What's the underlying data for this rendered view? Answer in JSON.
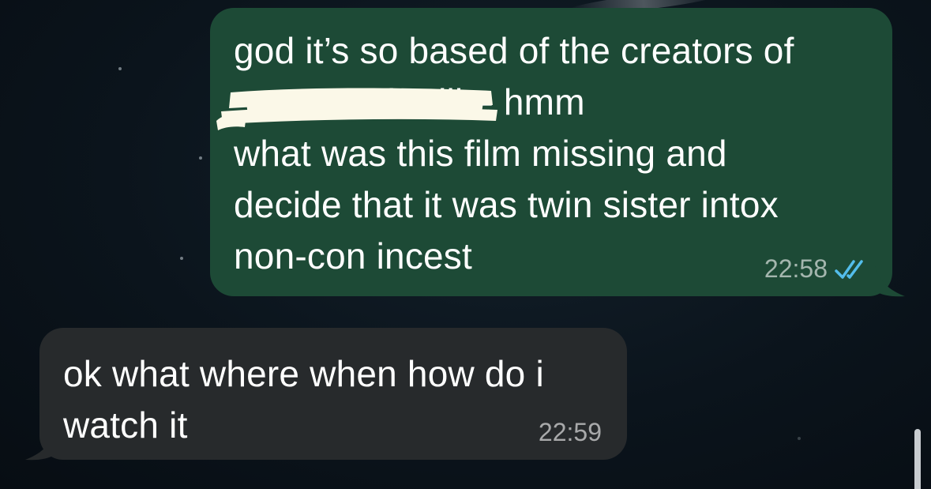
{
  "conversation": {
    "messages": [
      {
        "direction": "outgoing",
        "text": "god it’s so based of the creators of\n           to be like hmm\nwhat was this film missing and\ndecide that it was twin sister intox\nnon-con incest",
        "time": "22:58",
        "status_icon": "double-check-read-icon"
      },
      {
        "direction": "incoming",
        "text": "ok what where when how do i\nwatch it",
        "time": "22:59"
      }
    ]
  },
  "colors": {
    "outgoing_bubble": "#1d4a36",
    "incoming_bubble": "#272a2c",
    "read_receipt": "#53bdeb",
    "redaction": "#fbf8e8"
  }
}
